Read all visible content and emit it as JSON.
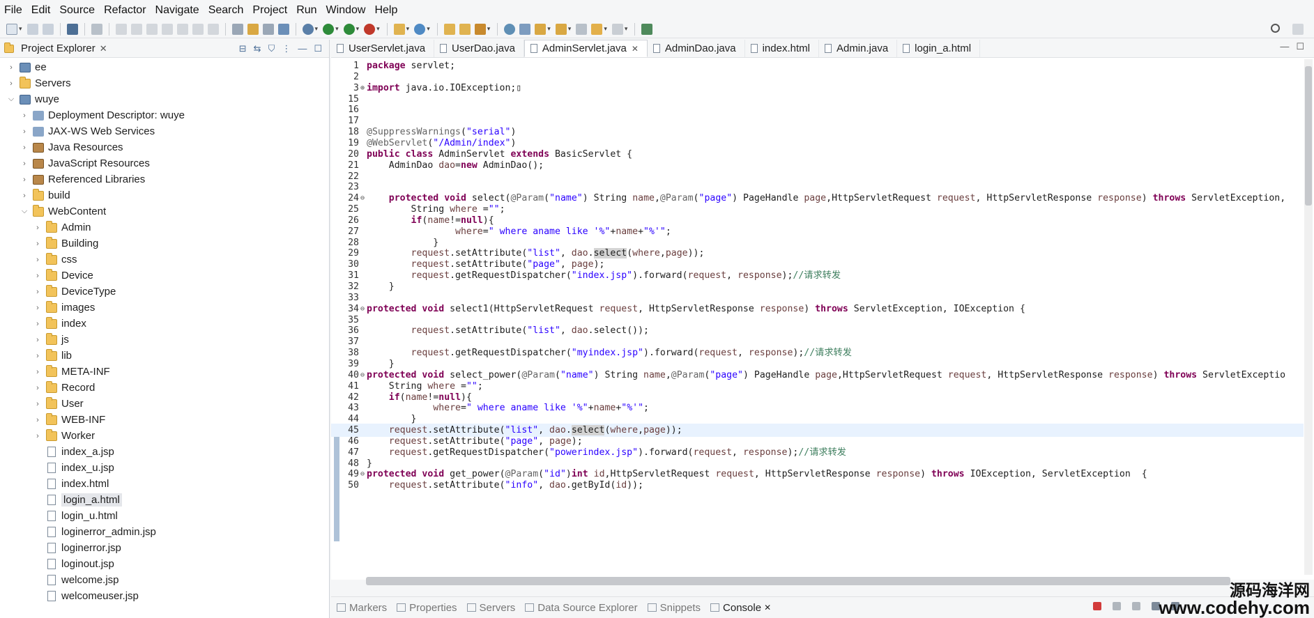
{
  "menu": [
    "File",
    "Edit",
    "Source",
    "Refactor",
    "Navigate",
    "Search",
    "Project",
    "Run",
    "Window",
    "Help"
  ],
  "explorer": {
    "title": "Project Explorer",
    "items": [
      {
        "label": "ee",
        "depth": 0,
        "type": "project",
        "open": false
      },
      {
        "label": "Servers",
        "depth": 0,
        "type": "folder",
        "open": false
      },
      {
        "label": "wuye",
        "depth": 0,
        "type": "project",
        "open": true
      },
      {
        "label": "Deployment Descriptor: wuye",
        "depth": 1,
        "type": "srv",
        "open": false
      },
      {
        "label": "JAX-WS Web Services",
        "depth": 1,
        "type": "srv",
        "open": false
      },
      {
        "label": "Java Resources",
        "depth": 1,
        "type": "jar",
        "open": false
      },
      {
        "label": "JavaScript Resources",
        "depth": 1,
        "type": "jar",
        "open": false
      },
      {
        "label": "Referenced Libraries",
        "depth": 1,
        "type": "jar",
        "open": false
      },
      {
        "label": "build",
        "depth": 1,
        "type": "folder",
        "open": false
      },
      {
        "label": "WebContent",
        "depth": 1,
        "type": "folder",
        "open": true
      },
      {
        "label": "Admin",
        "depth": 2,
        "type": "folder",
        "open": false
      },
      {
        "label": "Building",
        "depth": 2,
        "type": "folder",
        "open": false
      },
      {
        "label": "css",
        "depth": 2,
        "type": "folder",
        "open": false
      },
      {
        "label": "Device",
        "depth": 2,
        "type": "folder",
        "open": false
      },
      {
        "label": "DeviceType",
        "depth": 2,
        "type": "folder",
        "open": false
      },
      {
        "label": "images",
        "depth": 2,
        "type": "folder",
        "open": false
      },
      {
        "label": "index",
        "depth": 2,
        "type": "folder",
        "open": false
      },
      {
        "label": "js",
        "depth": 2,
        "type": "folder",
        "open": false
      },
      {
        "label": "lib",
        "depth": 2,
        "type": "folder",
        "open": false
      },
      {
        "label": "META-INF",
        "depth": 2,
        "type": "folder",
        "open": false
      },
      {
        "label": "Record",
        "depth": 2,
        "type": "folder",
        "open": false
      },
      {
        "label": "User",
        "depth": 2,
        "type": "folder",
        "open": false
      },
      {
        "label": "WEB-INF",
        "depth": 2,
        "type": "folder",
        "open": false
      },
      {
        "label": "Worker",
        "depth": 2,
        "type": "folder",
        "open": false
      },
      {
        "label": "index_a.jsp",
        "depth": 2,
        "type": "file"
      },
      {
        "label": "index_u.jsp",
        "depth": 2,
        "type": "file"
      },
      {
        "label": "index.html",
        "depth": 2,
        "type": "file"
      },
      {
        "label": "login_a.html",
        "depth": 2,
        "type": "file",
        "selected": true
      },
      {
        "label": "login_u.html",
        "depth": 2,
        "type": "file"
      },
      {
        "label": "loginerror_admin.jsp",
        "depth": 2,
        "type": "file"
      },
      {
        "label": "loginerror.jsp",
        "depth": 2,
        "type": "file"
      },
      {
        "label": "loginout.jsp",
        "depth": 2,
        "type": "file"
      },
      {
        "label": "welcome.jsp",
        "depth": 2,
        "type": "file"
      },
      {
        "label": "welcomeuser.jsp",
        "depth": 2,
        "type": "file"
      }
    ]
  },
  "editor": {
    "tabs": [
      {
        "label": "UserServlet.java",
        "active": false
      },
      {
        "label": "UserDao.java",
        "active": false
      },
      {
        "label": "AdminServlet.java",
        "active": true
      },
      {
        "label": "AdminDao.java",
        "active": false
      },
      {
        "label": "index.html",
        "active": false
      },
      {
        "label": "Admin.java",
        "active": false
      },
      {
        "label": "login_a.html",
        "active": false
      }
    ],
    "lines": [
      {
        "n": "1",
        "html": "<span class='kw'>package</span> servlet;"
      },
      {
        "n": "2",
        "html": ""
      },
      {
        "n": "3",
        "fold": "+",
        "html": "<span class='kw'>import</span> java.io.IOException;&#x25AF;"
      },
      {
        "n": "15",
        "html": ""
      },
      {
        "n": "16",
        "html": ""
      },
      {
        "n": "17",
        "html": ""
      },
      {
        "n": "18",
        "html": "<span class='ann'>@SuppressWarnings</span>(<span class='str'>\"serial\"</span>)"
      },
      {
        "n": "19",
        "html": "<span class='ann'>@WebServlet</span>(<span class='str'>\"/Admin/index\"</span>)"
      },
      {
        "n": "20",
        "html": "<span class='kw'>public</span> <span class='kw'>class</span> AdminServlet <span class='kw'>extends</span> BasicServlet {"
      },
      {
        "n": "21",
        "html": "    AdminDao <span class='var'>dao</span>=<span class='kw'>new</span> AdminDao();"
      },
      {
        "n": "22",
        "html": ""
      },
      {
        "n": "23",
        "html": ""
      },
      {
        "n": "24",
        "fold": "-",
        "html": "    <span class='kw'>protected</span> <span class='kw'>void</span> select(<span class='ann'>@Param</span>(<span class='str'>\"name\"</span>) String <span class='var'>name</span>,<span class='ann'>@Param</span>(<span class='str'>\"page\"</span>) PageHandle <span class='var'>page</span>,HttpServletRequest <span class='var'>request</span>, HttpServletResponse <span class='var'>response</span>) <span class='kw'>throws</span> ServletException,"
      },
      {
        "n": "25",
        "html": "        String <span class='var'>where</span> =<span class='str'>\"\"</span>;"
      },
      {
        "n": "26",
        "html": "        <span class='kw'>if</span>(<span class='var'>name</span>!=<span class='kw'>null</span>){"
      },
      {
        "n": "27",
        "html": "                <span class='var'>where</span>=<span class='str'>\" where aname like '%\"</span>+<span class='var'>name</span>+<span class='str'>\"%'\"</span>;"
      },
      {
        "n": "28",
        "html": "            }"
      },
      {
        "n": "29",
        "html": "        <span class='var'>request</span>.setAttribute(<span class='str'>\"list\"</span>, <span class='var'>dao</span>.<span class='mark'>select</span>(<span class='var'>where</span>,<span class='var'>page</span>));"
      },
      {
        "n": "30",
        "html": "        <span class='var'>request</span>.setAttribute(<span class='str'>\"page\"</span>, <span class='var'>page</span>);"
      },
      {
        "n": "31",
        "html": "        <span class='var'>request</span>.getRequestDispatcher(<span class='str'>\"index.jsp\"</span>).forward(<span class='var'>request</span>, <span class='var'>response</span>);<span class='com'>//请求转发</span>"
      },
      {
        "n": "32",
        "html": "    }"
      },
      {
        "n": "33",
        "html": ""
      },
      {
        "n": "34",
        "fold": "-",
        "html": "<span class='kw'>protected</span> <span class='kw'>void</span> select1(HttpServletRequest <span class='var'>request</span>, HttpServletResponse <span class='var'>response</span>) <span class='kw'>throws</span> ServletException, IOException {"
      },
      {
        "n": "35",
        "html": ""
      },
      {
        "n": "36",
        "html": "        <span class='var'>request</span>.setAttribute(<span class='str'>\"list\"</span>, <span class='var'>dao</span>.select());"
      },
      {
        "n": "37",
        "html": ""
      },
      {
        "n": "38",
        "html": "        <span class='var'>request</span>.getRequestDispatcher(<span class='str'>\"myindex.jsp\"</span>).forward(<span class='var'>request</span>, <span class='var'>response</span>);<span class='com'>//请求转发</span>"
      },
      {
        "n": "39",
        "html": "    }"
      },
      {
        "n": "40",
        "fold": "-",
        "html": "<span class='kw'>protected</span> <span class='kw'>void</span> select_power(<span class='ann'>@Param</span>(<span class='str'>\"name\"</span>) String <span class='var'>name</span>,<span class='ann'>@Param</span>(<span class='str'>\"page\"</span>) PageHandle <span class='var'>page</span>,HttpServletRequest <span class='var'>request</span>, HttpServletResponse <span class='var'>response</span>) <span class='kw'>throws</span> ServletExceptio"
      },
      {
        "n": "41",
        "html": "    String <span class='var'>where</span> =<span class='str'>\"\"</span>;"
      },
      {
        "n": "42",
        "html": "    <span class='kw'>if</span>(<span class='var'>name</span>!=<span class='kw'>null</span>){"
      },
      {
        "n": "43",
        "html": "            <span class='var'>where</span>=<span class='str'>\" where aname like '%\"</span>+<span class='var'>name</span>+<span class='str'>\"%'\"</span>;"
      },
      {
        "n": "44",
        "html": "        }"
      },
      {
        "n": "45",
        "hl": true,
        "html": "    <span class='var'>request</span>.setAttribute(<span class='str'>\"list\"</span>, <span class='var'>dao</span>.<span class='mark'>select</span>(<span class='var'>where</span>,<span class='var'>page</span>));"
      },
      {
        "n": "46",
        "html": "    <span class='var'>request</span>.setAttribute(<span class='str'>\"page\"</span>, <span class='var'>page</span>);"
      },
      {
        "n": "47",
        "html": "    <span class='var'>request</span>.getRequestDispatcher(<span class='str'>\"powerindex.jsp\"</span>).forward(<span class='var'>request</span>, <span class='var'>response</span>);<span class='com'>//请求转发</span>"
      },
      {
        "n": "48",
        "html": "}"
      },
      {
        "n": "49",
        "fold": "-",
        "html": "<span class='kw'>protected</span> <span class='kw'>void</span> get_power(<span class='ann'>@Param</span>(<span class='str'>\"id\"</span>)<span class='kw'>int</span> <span class='var'>id</span>,HttpServletRequest <span class='var'>request</span>, HttpServletResponse <span class='var'>response</span>) <span class='kw'>throws</span> IOException, ServletException  {"
      },
      {
        "n": "50",
        "html": "    <span class='var'>request</span>.setAttribute(<span class='str'>\"info\"</span>, <span class='var'>dao</span>.getById(<span class='var'>id</span>));"
      }
    ]
  },
  "bottom_tabs": [
    {
      "label": "Markers",
      "active": false
    },
    {
      "label": "Properties",
      "active": false
    },
    {
      "label": "Servers",
      "active": false
    },
    {
      "label": "Data Source Explorer",
      "active": false
    },
    {
      "label": "Snippets",
      "active": false
    },
    {
      "label": "Console",
      "active": true
    }
  ],
  "watermark": {
    "line1": "源码海洋网",
    "line2": "www.codehy.com"
  },
  "colors": {
    "keyword": "#7f0055",
    "string": "#2a00ff",
    "annotation": "#646464",
    "variable": "#6a3e3e",
    "comment": "#3f7f5f",
    "line_highlight": "#e8f2fe"
  }
}
